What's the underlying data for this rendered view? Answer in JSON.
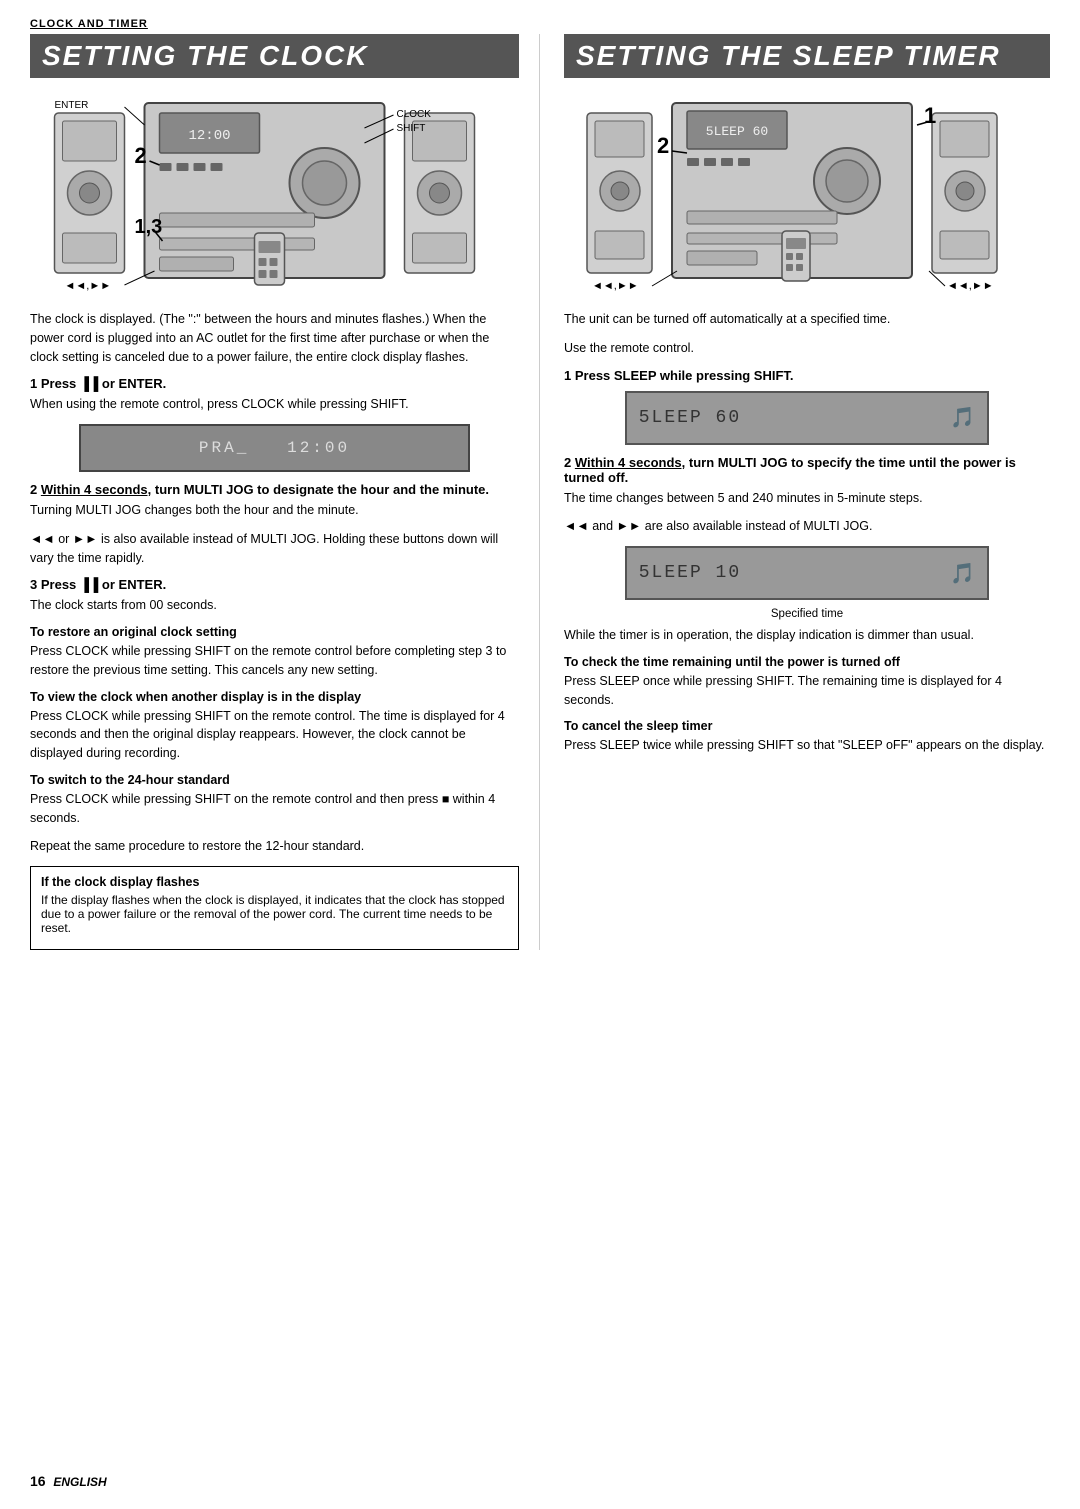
{
  "header": {
    "label": "CLOCK AND TIMER"
  },
  "left_column": {
    "title": "SETTING THE CLOCK",
    "intro_text": "The clock is displayed. (The \":\" between the hours and minutes flashes.) When the power cord is plugged into an AC outlet for the first time after purchase or when the clock setting is canceled due to a power failure, the entire clock display flashes.",
    "step1": {
      "number": "1",
      "heading": "Press ▐▐ or ENTER.",
      "detail": "When using the remote control, press CLOCK while pressing SHIFT."
    },
    "display1": "PRA_ 12:00",
    "step2": {
      "number": "2",
      "heading_underline": "Within 4 seconds,",
      "heading_rest": " turn MULTI JOG to designate the hour and the minute.",
      "detail1": "Turning MULTI JOG changes both the hour and the minute.",
      "detail2": "◄◄ or ►► is also available instead of MULTI JOG. Holding these buttons down will vary the time rapidly."
    },
    "step3": {
      "number": "3",
      "heading": "Press ▐▐ or ENTER.",
      "detail": "The clock starts from 00 seconds."
    },
    "sub_sections": [
      {
        "title": "To restore an original clock setting",
        "text": "Press CLOCK while pressing SHIFT on the remote control before completing step 3 to restore the previous time setting. This cancels any new setting."
      },
      {
        "title": "To view the clock when another display is in the display",
        "text": "Press CLOCK while pressing SHIFT on the remote control. The time is displayed for 4 seconds and then the original display reappears. However, the clock cannot be displayed during recording."
      },
      {
        "title": "To switch to the 24-hour standard",
        "text1": "Press CLOCK while pressing SHIFT on the remote control and then press ■ within 4 seconds.",
        "text2": "Repeat the same procedure to restore the 12-hour standard."
      }
    ],
    "notice_box": {
      "title": "If the clock display flashes",
      "text": "If the display flashes when the clock is displayed, it indicates that the clock has stopped due to a power failure or the removal of the power cord. The current time needs to be reset."
    }
  },
  "right_column": {
    "title": "SETTING THE SLEEP TIMER",
    "intro_text": "The unit can be turned off automatically at a specified time.",
    "use_remote": "Use the remote control.",
    "step1": {
      "number": "1",
      "heading": "Press SLEEP while pressing SHIFT."
    },
    "display1": "5LEEP 60",
    "step2": {
      "number": "2",
      "heading_underline": "Within 4 seconds,",
      "heading_rest": " turn MULTI JOG to specify the time until the power is turned off.",
      "detail1": "The time changes between 5 and 240 minutes in 5-minute steps.",
      "detail2": "◄◄ and ►► are also available instead of MULTI JOG."
    },
    "display2": "5LEEP 10",
    "display2_caption": "Specified time",
    "dimmer_text": "While the timer is in operation, the display indication is dimmer than usual.",
    "sub_sections": [
      {
        "title": "To check the time remaining until the power is turned off",
        "text": "Press SLEEP once while pressing SHIFT. The remaining time is displayed for 4 seconds."
      },
      {
        "title": "To cancel the sleep timer",
        "text": "Press SLEEP twice while pressing SHIFT so that \"SLEEP oFF\" appears on the display."
      }
    ]
  },
  "page_number": "16",
  "page_language": "ENGLISH",
  "diagram_left": {
    "labels": [
      "ENTER",
      "CLOCK",
      "SHIFT"
    ],
    "numbers": [
      "2",
      "1,3"
    ],
    "arrows": [
      "◄◄,►►"
    ]
  },
  "diagram_right": {
    "numbers": [
      "2",
      "1"
    ],
    "arrows": [
      "◄◄,►►",
      "◄◄,►►"
    ]
  }
}
